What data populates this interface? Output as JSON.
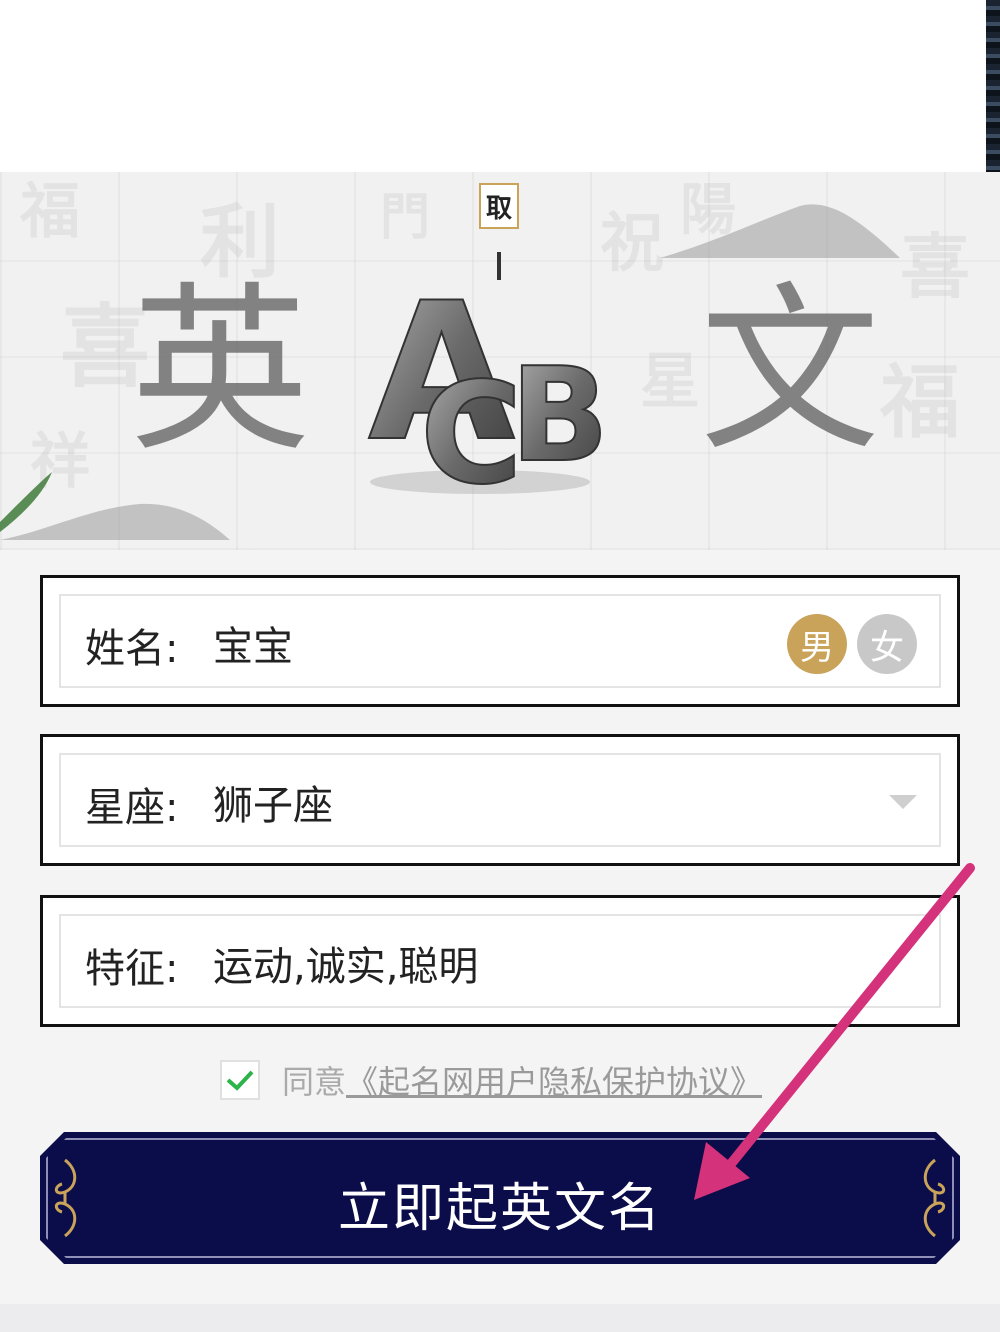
{
  "banner": {
    "seal_text": "取",
    "left_char": "英",
    "right_char": "文",
    "logo_letters": [
      "A",
      "C",
      "B"
    ]
  },
  "form": {
    "name": {
      "label": "姓名:",
      "value": "宝宝"
    },
    "gender": {
      "male": "男",
      "female": "女",
      "selected": "男"
    },
    "zodiac": {
      "label": "星座:",
      "value": "狮子座"
    },
    "traits": {
      "label": "特征:",
      "value": "运动,诚实,聪明"
    }
  },
  "agreement": {
    "checked": true,
    "prefix": "同意",
    "link": "《起名网用户隐私保护协议》"
  },
  "submit": {
    "label": "立即起英文名"
  },
  "colors": {
    "accent_gold": "#c9a35a",
    "gender_inactive": "#c8c8c8",
    "button_navy": "#0b0c4a",
    "annotation_arrow": "#d4327a",
    "check_green": "#2cb34a"
  },
  "icons": {
    "checkbox": "check-icon",
    "dropdown": "caret-down-icon",
    "ornament": "scroll-ornament-icon"
  }
}
